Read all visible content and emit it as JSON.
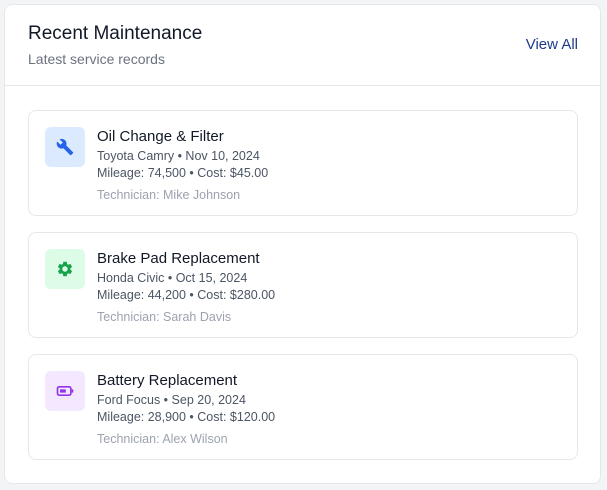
{
  "header": {
    "title": "Recent Maintenance",
    "subtitle": "Latest service records",
    "view_all_label": "View All"
  },
  "records": [
    {
      "title": "Oil Change & Filter",
      "vehicle_date": "Toyota Camry • Nov 10, 2024",
      "mileage_cost": "Mileage: 74,500 • Cost: $45.00",
      "technician": "Technician: Mike Johnson",
      "icon": "wrench-icon",
      "icon_color": "#2563eb",
      "icon_bg": "#dbeafe"
    },
    {
      "title": "Brake Pad Replacement",
      "vehicle_date": "Honda Civic • Oct 15, 2024",
      "mileage_cost": "Mileage: 44,200 • Cost: $280.00",
      "technician": "Technician: Sarah Davis",
      "icon": "gear-icon",
      "icon_color": "#16a34a",
      "icon_bg": "#dcfce7"
    },
    {
      "title": "Battery Replacement",
      "vehicle_date": "Ford Focus • Sep 20, 2024",
      "mileage_cost": "Mileage: 28,900 • Cost: $120.00",
      "technician": "Technician: Alex Wilson",
      "icon": "battery-icon",
      "icon_color": "#9333ea",
      "icon_bg": "#f3e8ff"
    }
  ]
}
